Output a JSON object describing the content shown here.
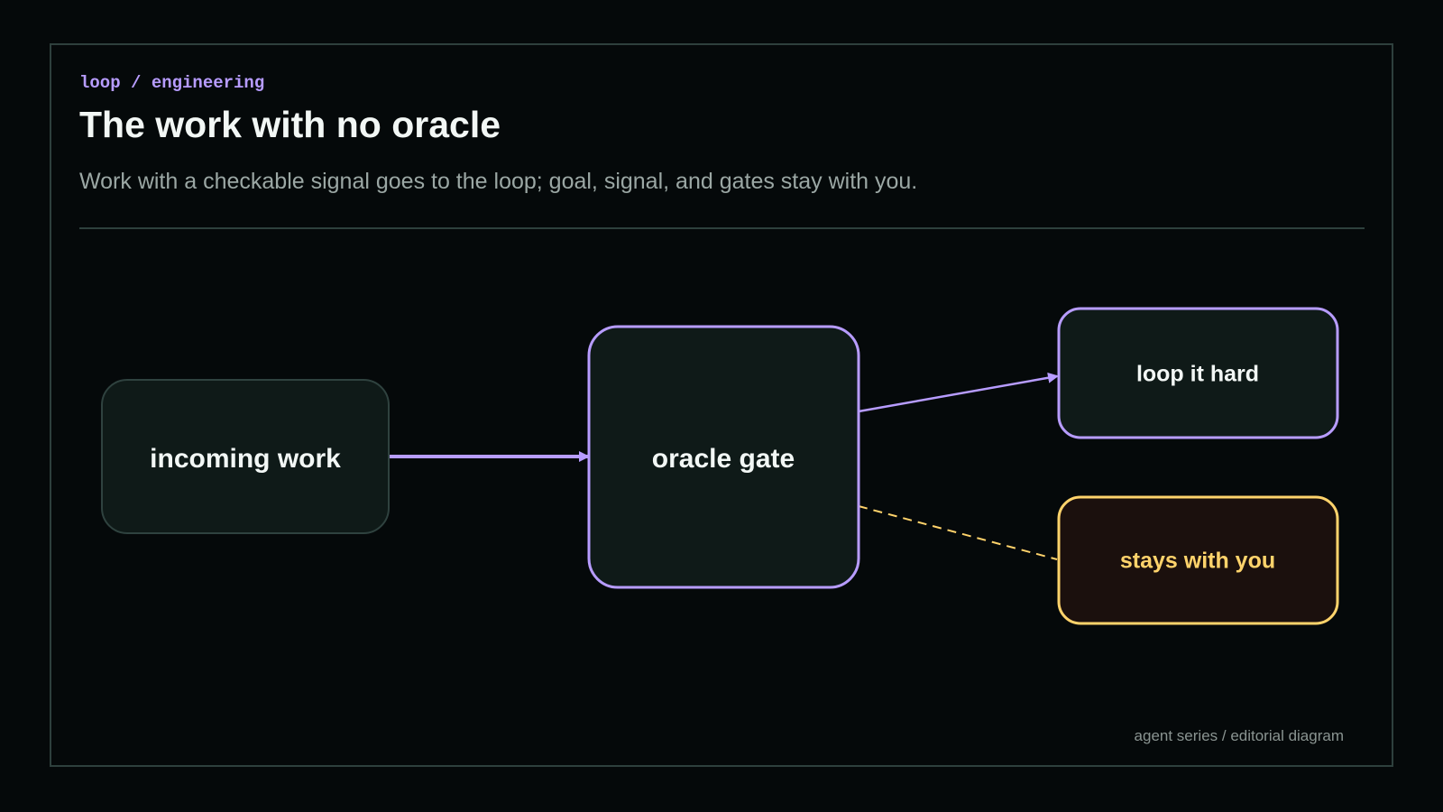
{
  "header": {
    "kicker": "loop / engineering",
    "title": "The work with no oracle",
    "subtitle": "Work with a checkable signal goes to the loop; goal, signal, and gates stay with you."
  },
  "diagram": {
    "nodes": {
      "incoming": "incoming work",
      "gate": "oracle gate",
      "loop": "loop it hard",
      "stays": "stays with you"
    },
    "colors": {
      "accent": "#b79cff",
      "warning": "#ffd36b",
      "node_fill": "#0f1a18",
      "warm_fill": "#1b100d",
      "neutral_border": "#2f423f",
      "label": "#f2f7f5"
    }
  },
  "footer": {
    "text": "agent series / editorial diagram"
  }
}
